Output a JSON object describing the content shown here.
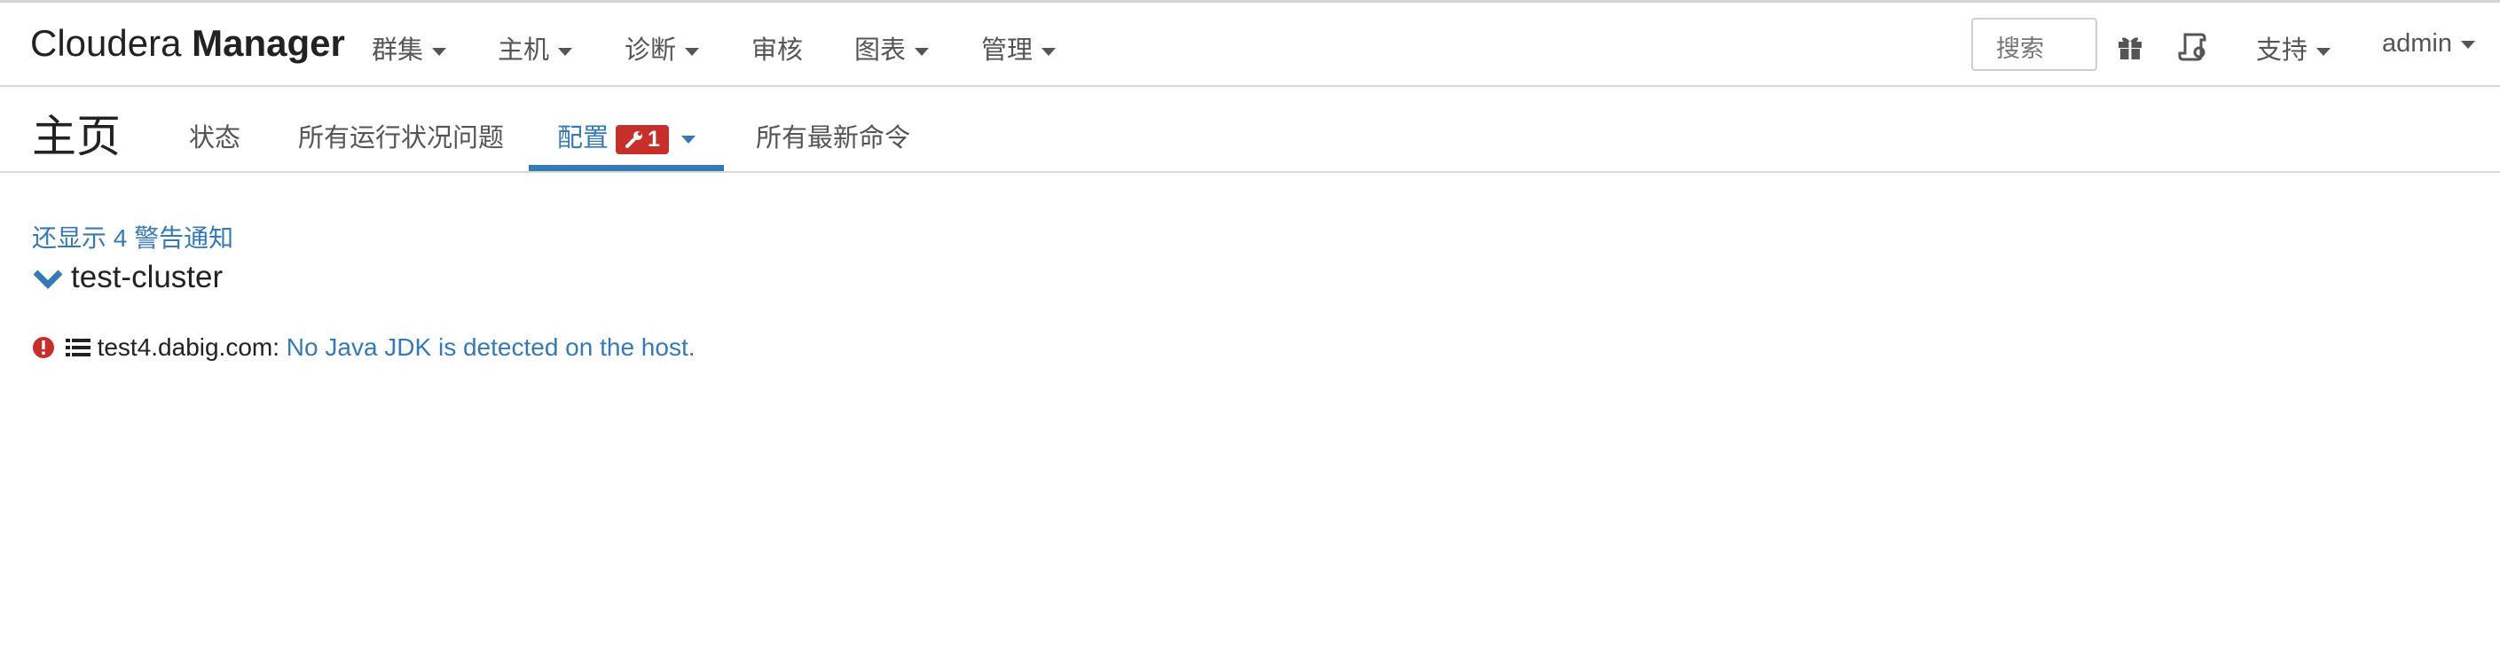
{
  "header": {
    "brand_light": "Cloudera",
    "brand_bold": "Manager",
    "menu": [
      {
        "label": "群集"
      },
      {
        "label": "主机"
      },
      {
        "label": "诊断"
      },
      {
        "label": "审核"
      },
      {
        "label": "图表"
      },
      {
        "label": "管理"
      }
    ],
    "search_placeholder": "搜索",
    "support_label": "支持",
    "user_label": "admin",
    "icons": [
      "gift-icon",
      "parcel-icon"
    ]
  },
  "subnav": {
    "page_title": "主页",
    "tabs": [
      {
        "label": "状态"
      },
      {
        "label": "所有运行状况问题"
      },
      {
        "label": "配置",
        "badge": "1",
        "active": true
      },
      {
        "label": "所有最新命令"
      }
    ]
  },
  "main": {
    "show_more": "还显示 4 警告通知",
    "cluster_name": "test-cluster",
    "issues": [
      {
        "host": "test4.dabig.com:",
        "message": "No Java JDK is detected on the host."
      }
    ]
  },
  "colors": {
    "accent": "#337ab7",
    "error": "#c62f2a",
    "text": "#333333"
  }
}
